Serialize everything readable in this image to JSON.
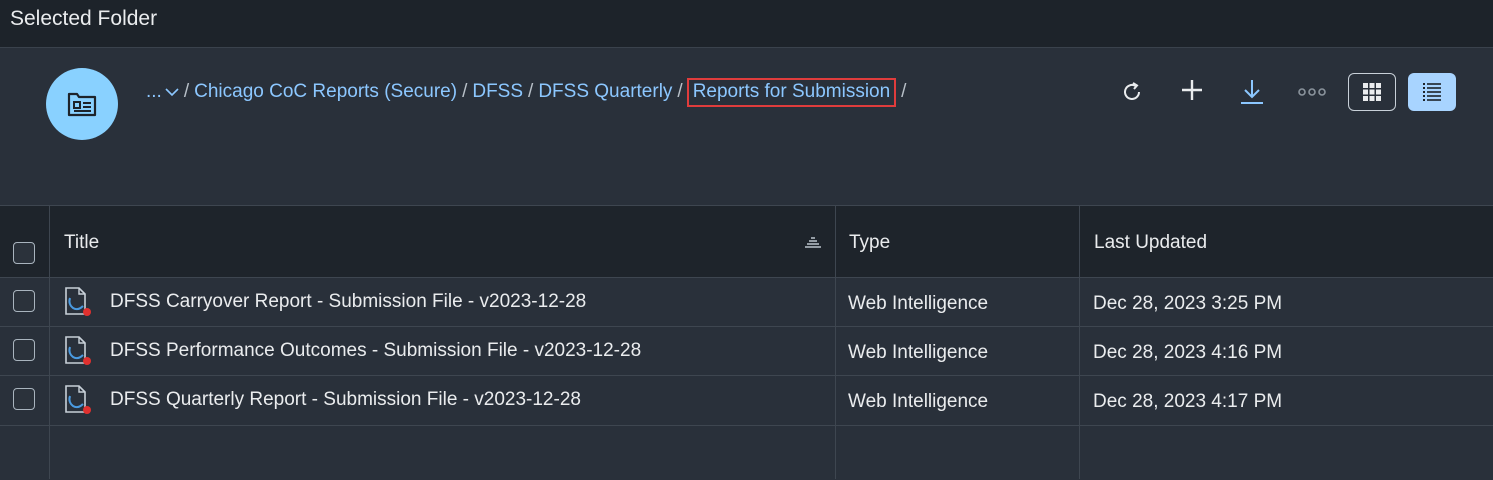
{
  "page": {
    "title": "Selected Folder"
  },
  "breadcrumb": {
    "ellipsis": "...",
    "separator": "/",
    "items": [
      "Chicago CoC Reports (Secure)",
      "DFSS",
      "DFSS Quarterly"
    ],
    "current": "Reports for Submission"
  },
  "toolbar": {
    "icons": [
      "refresh-icon",
      "add-icon",
      "download-icon",
      "more-icon",
      "grid-view-icon",
      "list-view-icon"
    ],
    "active_view": "list"
  },
  "table": {
    "columns": [
      "Title",
      "Type",
      "Last Updated"
    ],
    "rows": [
      {
        "title": "DFSS Carryover Report - Submission File - v2023-12-28",
        "type": "Web Intelligence",
        "updated": "Dec 28, 2023 3:25 PM"
      },
      {
        "title": "DFSS Performance Outcomes - Submission File - v2023-12-28",
        "type": "Web Intelligence",
        "updated": "Dec 28, 2023 4:16 PM"
      },
      {
        "title": "DFSS Quarterly Report - Submission File - v2023-12-28",
        "type": "Web Intelligence",
        "updated": "Dec 28, 2023 4:17 PM"
      }
    ]
  },
  "colors": {
    "background": "#29303a",
    "header_bar": "#1d232a",
    "link": "#8cc7ff",
    "avatar": "#89d1ff",
    "highlight_border": "#e03c3c",
    "active_toggle": "#a8d4ff"
  }
}
